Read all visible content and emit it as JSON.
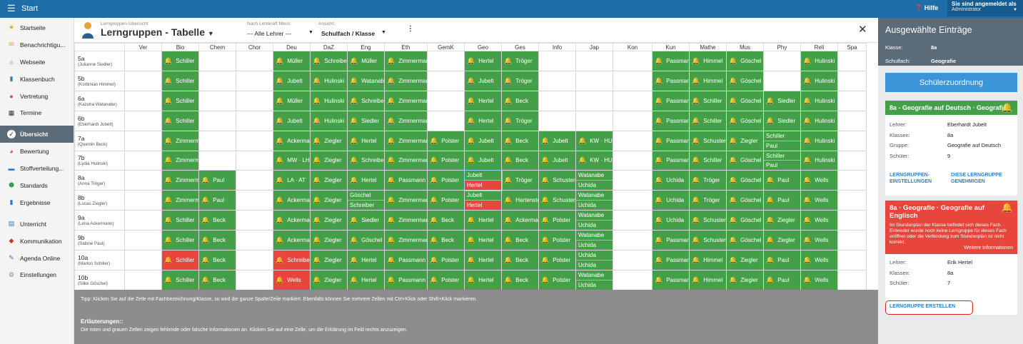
{
  "topbar": {
    "menu_icon": "☰",
    "start": "Start",
    "help": "Hilfe",
    "user_line1": "Sie sind angemeldet als",
    "user_line2": "Administrator"
  },
  "sidebar": {
    "items": [
      {
        "label": "Startseite",
        "icon": "star-icon"
      },
      {
        "label": "Benachrichtigu...",
        "icon": "mail-icon"
      },
      {
        "label": "Webseite",
        "icon": "home-icon"
      },
      {
        "label": "Klassenbuch",
        "icon": "book-icon"
      },
      {
        "label": "Vertretung",
        "icon": "person-icon"
      },
      {
        "label": "Termine",
        "icon": "calendar-icon"
      },
      {
        "label": "Übersicht",
        "icon": "check-icon"
      },
      {
        "label": "Bewertung",
        "icon": "rating-icon"
      },
      {
        "label": "Stoffverteilung...",
        "icon": "briefcase-icon"
      },
      {
        "label": "Standards",
        "icon": "shield-icon"
      },
      {
        "label": "Ergebnisse",
        "icon": "bar-chart-icon"
      },
      {
        "label": "Unterricht",
        "icon": "lesson-icon"
      },
      {
        "label": "Kommunikation",
        "icon": "communication-icon"
      },
      {
        "label": "Agenda Online",
        "icon": "pen-icon"
      },
      {
        "label": "Einstellungen",
        "icon": "gear-icon"
      }
    ]
  },
  "header": {
    "subtitle": "Lerngruppen-Übersicht",
    "title": "Lerngruppen - Tabelle",
    "filter_label": "Nach Lehrkraft filtern:",
    "filter_value": "--- Alle Lehrer ---",
    "view_label": "Ansicht:",
    "view_value": "Schulfach / Klasse"
  },
  "table": {
    "columns": [
      "Ver",
      "Bio",
      "Chem",
      "Chor",
      "Deu",
      "DaZ",
      "Eng",
      "Eth",
      "GemK",
      "Geo",
      "Ges",
      "Info",
      "Jap",
      "Kon",
      "Kun",
      "Mathe",
      "Mus",
      "Phy",
      "Reli",
      "Spa"
    ],
    "rows": [
      {
        "class": "5a",
        "teacher": "(Julianne Siedler)",
        "cells": [
          "",
          "Schiller",
          "",
          "",
          "Müller",
          "Schreiber",
          "Müller",
          "Zimmermann",
          "",
          "Hertel",
          "Tröger",
          "",
          "",
          "",
          "Passmann",
          "Himmel",
          "Göschel",
          "",
          "Hulinski",
          ""
        ]
      },
      {
        "class": "5b",
        "teacher": "(Korbinian Himmel)",
        "cells": [
          "",
          "Schiller",
          "",
          "",
          "Jubelt",
          "Hulinski",
          "Watanabe",
          "Zimmermann",
          "",
          "Jubelt",
          "Tröger",
          "",
          "",
          "",
          "Passmann",
          "Himmel",
          "Göschel",
          "",
          "Hulinski",
          ""
        ]
      },
      {
        "class": "6a",
        "teacher": "(Kazuha Watanabe)",
        "cells": [
          "",
          "Schiller",
          "",
          "",
          "Müller",
          "Hulinski",
          "Schreiber",
          "Zimmermann",
          "",
          "Hertel",
          "Beck",
          "",
          "",
          "",
          "Passmann",
          "Schiller",
          "Göschel",
          "Siedler",
          "Hulinski",
          ""
        ]
      },
      {
        "class": "6b",
        "teacher": "(Eberhardt Jubelt)",
        "cells": [
          "",
          "Schiller",
          "",
          "",
          "Jubelt",
          "Hulinski",
          "Siedler",
          "Zimmermann",
          "",
          "Hertel",
          "Tröger",
          "",
          "",
          "",
          "Passmann",
          "Schiller",
          "Göschel",
          "Siedler",
          "Hulinski",
          ""
        ]
      },
      {
        "class": "7a",
        "teacher": "(Quentin Beck)",
        "cells": [
          "",
          "Zimmermann",
          "",
          "",
          "Ackermann",
          "Ziegler",
          "Hertel",
          "Zimmermann",
          "Polster",
          "Jubelt",
          "Beck",
          "Jubelt",
          "KW · HU",
          "",
          "Passmann",
          "Schuster",
          "Ziegler",
          "Schiller|Paul",
          "Hulinski",
          ""
        ]
      },
      {
        "class": "7b",
        "teacher": "(Lydia Hulinski)",
        "cells": [
          "",
          "Zimmermann",
          "",
          "",
          "MW · LH",
          "Ziegler",
          "Schreiber",
          "Zimmermann",
          "Polster",
          "Jubelt",
          "Beck",
          "Jubelt",
          "KW · HU",
          "",
          "Passmann",
          "Schiller",
          "Göschel",
          "Schiller|Paul",
          "Hulinski",
          ""
        ]
      },
      {
        "class": "8a",
        "teacher": "(Anna Tröger)",
        "cells": [
          "",
          "Zimmermann",
          "Paul",
          "",
          "LA · AT",
          "Ziegler",
          "Hertel",
          "Passmann",
          "Polster",
          "Jubelt|Hertel",
          "Tröger",
          "Schuster",
          "Watanabe|Uchida",
          "",
          "Uchida",
          "Tröger",
          "Göschel",
          "Paul",
          "Wells",
          ""
        ]
      },
      {
        "class": "8b",
        "teacher": "(Lucas Ziegler)",
        "cells": [
          "",
          "Zimmermann",
          "Paul",
          "",
          "Ackermann",
          "Ziegler",
          "Göschel|Schreiber",
          "Zimmermann",
          "Polster",
          "Jubelt|Hertel",
          "Hartenstein",
          "Schuster",
          "Watanabe|Uchida",
          "",
          "Uchida",
          "Tröger",
          "Göschel",
          "Paul",
          "Wells",
          ""
        ]
      },
      {
        "class": "9a",
        "teacher": "(Lena Ackermann)",
        "cells": [
          "",
          "Schiller",
          "Beck",
          "",
          "Ackermann",
          "Ziegler",
          "Siedler",
          "Zimmermann",
          "Beck",
          "Hertel",
          "Ackermann",
          "Polster",
          "Watanabe|Uchida",
          "",
          "Uchida",
          "Schuster",
          "Göschel",
          "Ziegler",
          "Wells",
          ""
        ]
      },
      {
        "class": "9b",
        "teacher": "(Sabine Paul)",
        "cells": [
          "",
          "Schiller",
          "Beck",
          "",
          "Ackermann",
          "Ziegler",
          "Göschel",
          "Zimmermann",
          "Beck",
          "Hertel",
          "Beck",
          "Polster",
          "Watanabe|Uchida",
          "",
          "Passmann",
          "Schuster",
          "Göschel",
          "Ziegler",
          "Wells",
          ""
        ]
      },
      {
        "class": "10a",
        "teacher": "(Marion Schiller)",
        "cells": [
          "",
          "Schiller",
          "Beck",
          "",
          "Schreiber",
          "Ziegler",
          "Hertel",
          "Passmann",
          "Polster",
          "Hertel",
          "Beck",
          "Polster",
          "Uchida|Uchida",
          "",
          "Passmann",
          "Himmel",
          "Ziegler",
          "Paul",
          "Wells",
          ""
        ]
      },
      {
        "class": "10b",
        "teacher": "(Silke Göschel)",
        "cells": [
          "",
          "Schiller",
          "Beck",
          "",
          "Wells",
          "Ziegler",
          "Hertel",
          "Passmann",
          "Polster",
          "Hertel",
          "Beck",
          "Polster",
          "Watanabe|Uchida",
          "",
          "Passmann",
          "Himmel",
          "Ziegler",
          "Paul",
          "Wells",
          ""
        ]
      }
    ]
  },
  "footer": {
    "tip": "Tipp: Klicken Sie auf die Zelle mit Fachbezeichnung/Klasse, so wird die ganze Spalte/Zeile markiert. Ebenfalls können Sie mehrere Zellen mit Ctrl+Klick oder Shift+Klick markieren.",
    "explanations_heading": "Erläuterungen::",
    "explanations_text": "Die roten und grauen Zellen zeigen fehlende oder falsche Informationen an. Klicken Sie auf eine Zelle, um die Erklärung im Feld rechts anzuzeigen."
  },
  "right": {
    "heading": "Ausgewählte Einträge",
    "klasse_label": "Klasse:",
    "klasse_value": "8a",
    "fach_label": "Schulfach:",
    "fach_value": "Geografie",
    "assign_button": "Schülerzuordnung",
    "card1": {
      "title": "8a - Geografie auf Deutsch · Geografie",
      "lehrer_label": "Lehrer:",
      "lehrer": "Eberhardt Jubelt",
      "klassen_label": "Klassen:",
      "klassen": "8a",
      "gruppe_label": "Gruppe:",
      "gruppe": "Geografie auf Deutsch",
      "schueler_label": "Schüler:",
      "schueler": "9",
      "link1": "LERNGRUPPEN-EINSTELLUNGEN",
      "link2": "DIESE LERNGRUPPE GENEHMIGEN"
    },
    "card2": {
      "title": "8a · Geografie · Geografie auf Englisch",
      "message": "Im Stundenplan der Klasse befindet sich dieses Fach. Entweder wurde noch keine Lerngruppe für dieses Fach eröffnet oder die Verbindung zum Stundenplan ist nicht korrekt.",
      "more": "Weitere Informationen",
      "lehrer_label": "Lehrer:",
      "lehrer": "Erik Hertel",
      "klassen_label": "Klassen:",
      "klassen": "8a",
      "schueler_label": "Schüler:",
      "schueler": "7",
      "create_link": "LERNGRUPPE ERSTELLEN"
    }
  },
  "colors": {
    "topbar": "#1f6ea8",
    "green": "#44a048",
    "red": "#e8453c",
    "panel": "#5b6b78",
    "button": "#3b95d6"
  }
}
